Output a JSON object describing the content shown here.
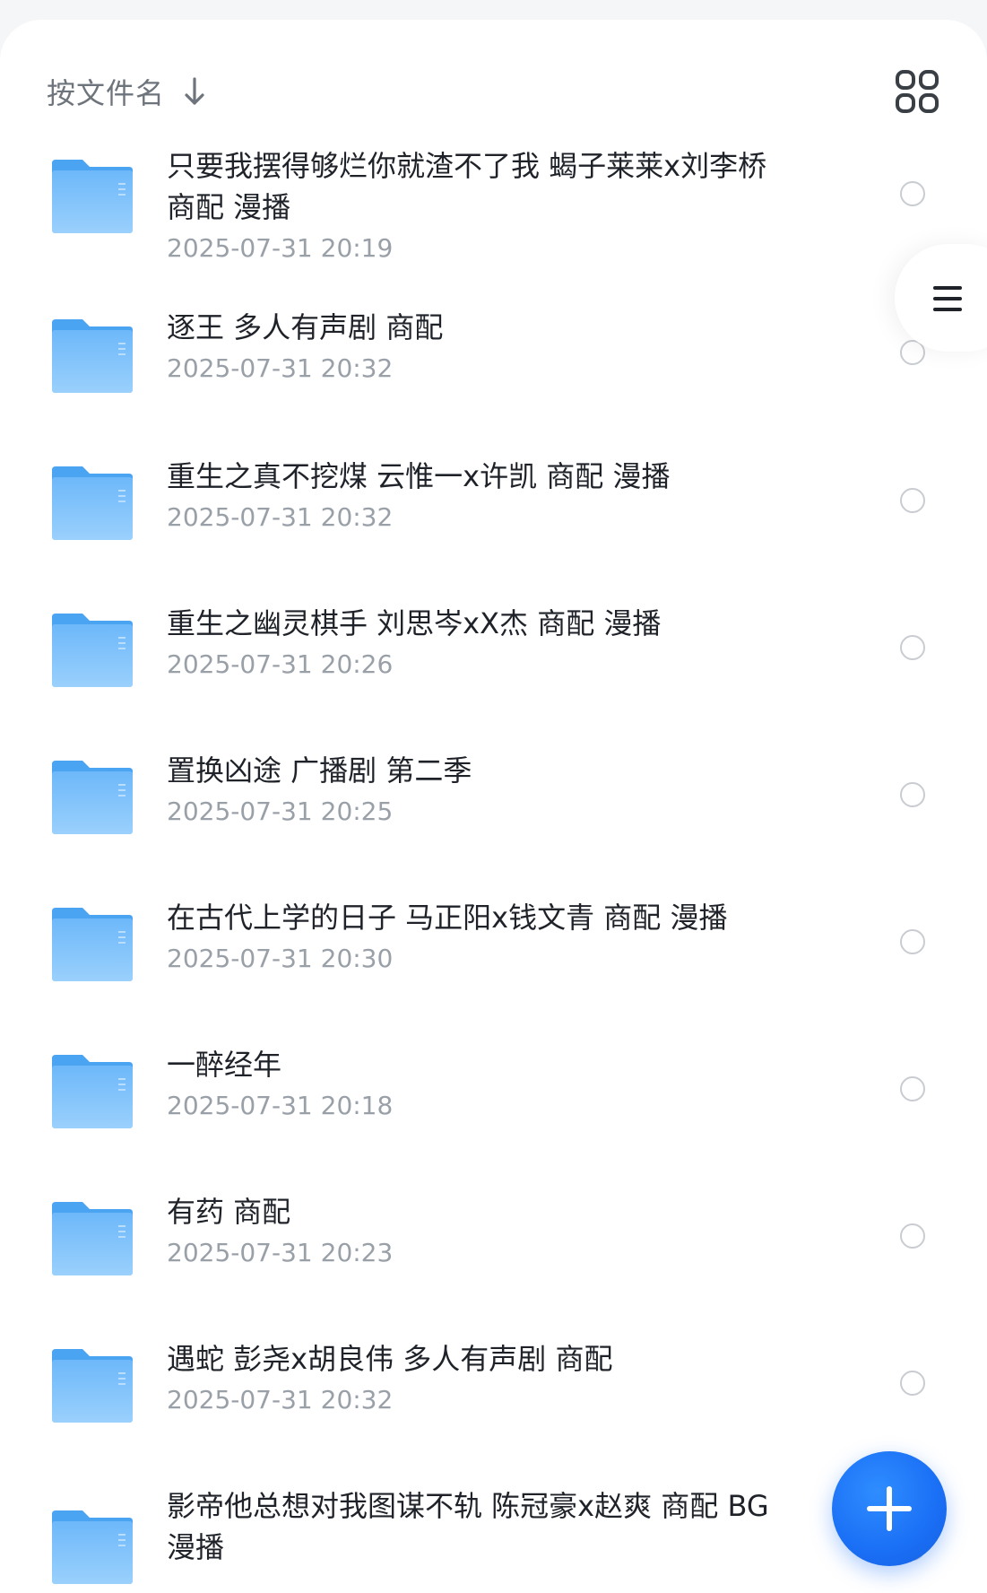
{
  "sort": {
    "label": "按文件名"
  },
  "icons": {
    "sort": "arrow-down-icon",
    "view_toggle": "grid-view-icon",
    "side_menu": "menu-icon",
    "folder": "folder-icon",
    "add": "plus-icon"
  },
  "colors": {
    "folder": "#63b1f7",
    "accent": "#1a6ff5"
  },
  "files": [
    {
      "name": "只要我摆得够烂你就渣不了我 蝎子莱莱x刘李桥\n商配 漫播",
      "date": "2025-07-31 20:19"
    },
    {
      "name": "逐王 多人有声剧 商配",
      "date": "2025-07-31 20:32"
    },
    {
      "name": "重生之真不挖煤 云惟一x许凯 商配 漫播",
      "date": "2025-07-31 20:32"
    },
    {
      "name": "重生之幽灵棋手 刘思岑xX杰 商配 漫播",
      "date": "2025-07-31 20:26"
    },
    {
      "name": "置换凶途 广播剧 第二季",
      "date": "2025-07-31 20:25"
    },
    {
      "name": "在古代上学的日子 马正阳x钱文青 商配 漫播",
      "date": "2025-07-31 20:30"
    },
    {
      "name": "一醉经年",
      "date": "2025-07-31 20:18"
    },
    {
      "name": "有药 商配",
      "date": "2025-07-31 20:23"
    },
    {
      "name": "遇蛇 彭尧x胡良伟 多人有声剧 商配",
      "date": "2025-07-31 20:32"
    },
    {
      "name": "影帝他总想对我图谋不轨 陈冠豪x赵爽 商配 BG\n漫播",
      "date": ""
    }
  ]
}
